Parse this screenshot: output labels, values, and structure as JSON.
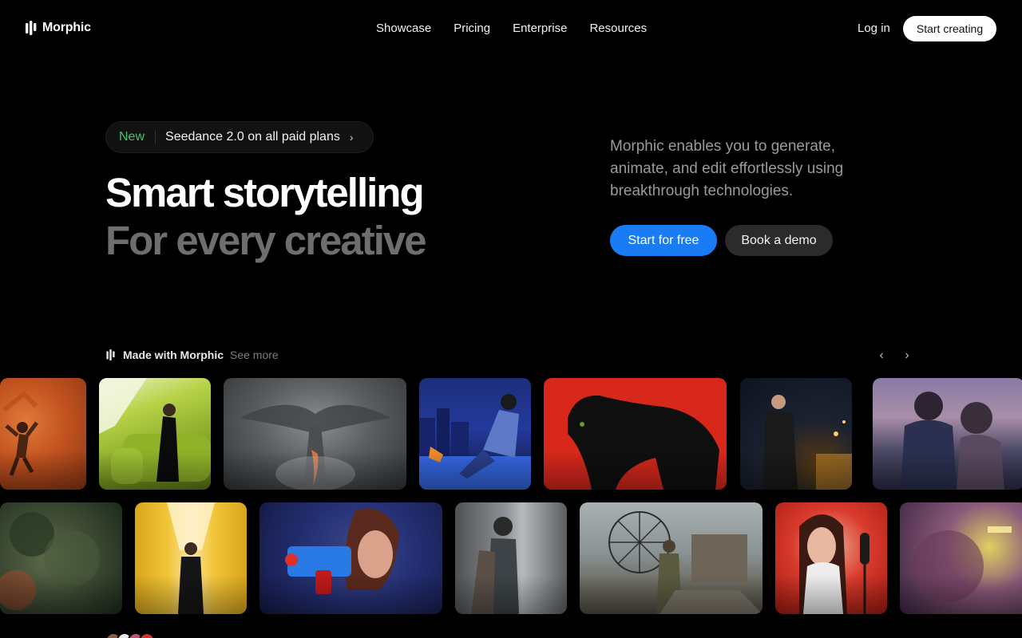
{
  "brand": {
    "name": "Morphic"
  },
  "nav": {
    "links": [
      "Showcase",
      "Pricing",
      "Enterprise",
      "Resources"
    ],
    "login": "Log in",
    "cta": "Start creating"
  },
  "hero": {
    "badge_tag": "New",
    "badge_text": "Seedance 2.0 on all paid plans",
    "title_line1": "Smart storytelling",
    "title_line2": "For every creative",
    "description": "Morphic enables you to generate, animate, and edit effortlessly using breakthrough technologies.",
    "primary_cta": "Start for free",
    "secondary_cta": "Book a demo"
  },
  "gallery": {
    "title": "Made with Morphic",
    "see_more": "See more"
  },
  "colors": {
    "accent": "#1a7cf5",
    "badge_tag": "#4cc26a",
    "title_muted": "#6e6e6e"
  }
}
